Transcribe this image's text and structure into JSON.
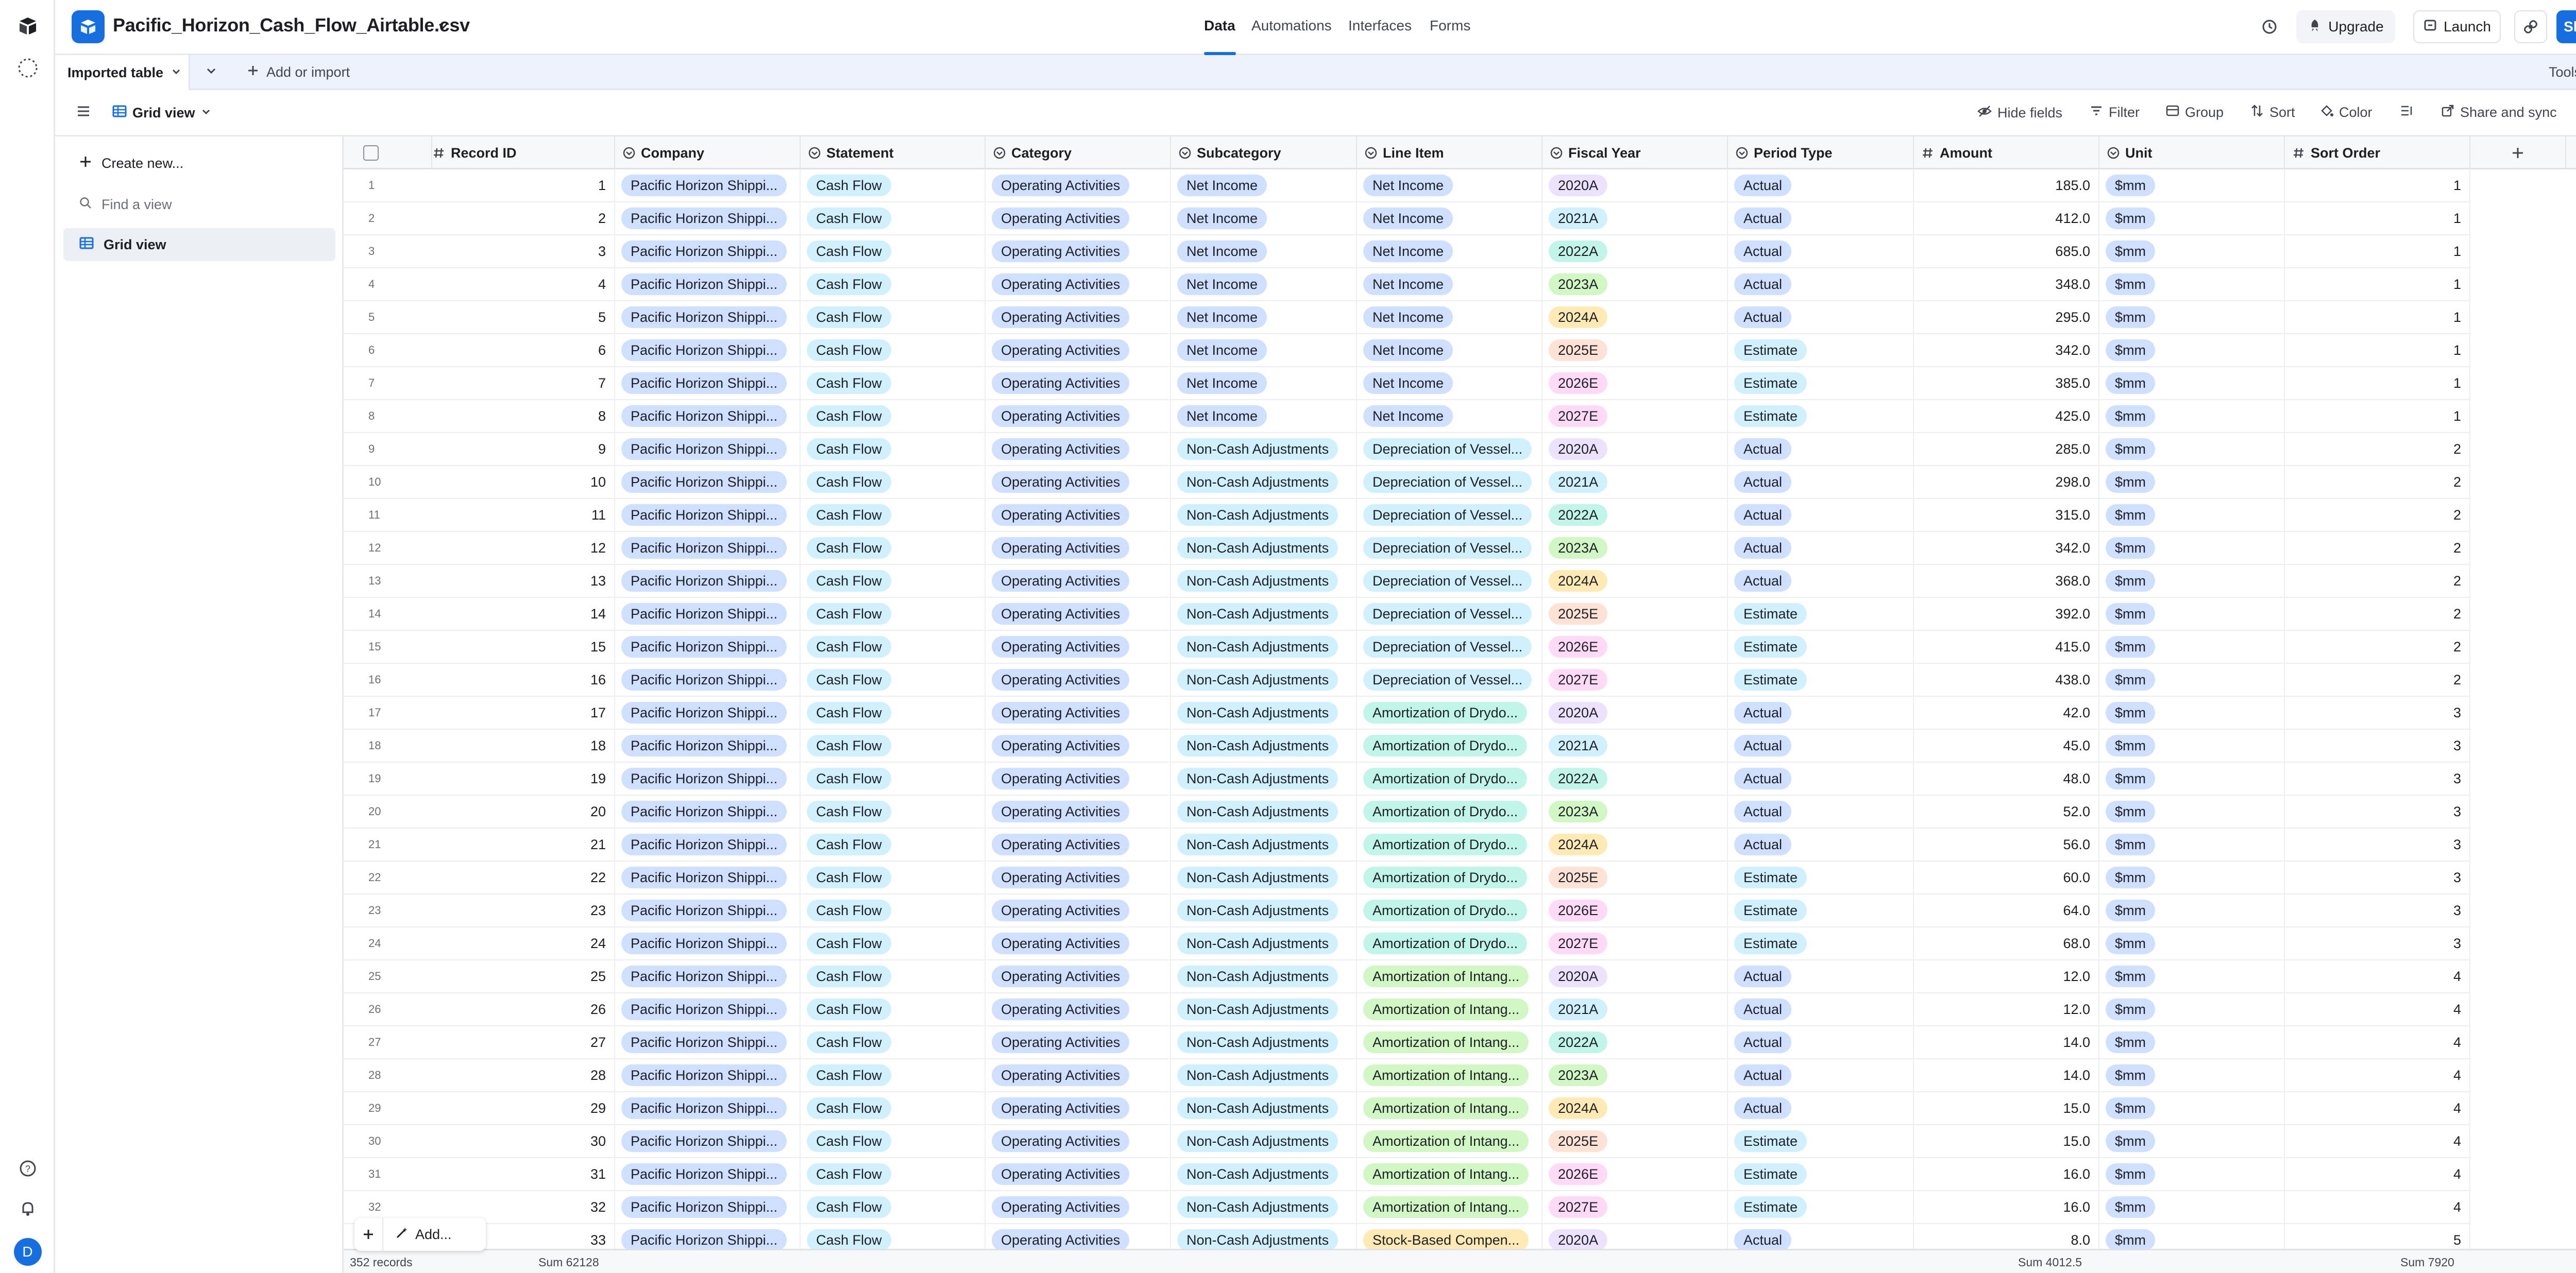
{
  "topbar": {
    "base_name": "Pacific_Horizon_Cash_Flow_Airtable.csv",
    "tabs": [
      "Data",
      "Automations",
      "Interfaces",
      "Forms"
    ],
    "upgrade_label": "Upgrade",
    "launch_label": "Launch",
    "share_label": "Share",
    "accent_color": "#166ee1"
  },
  "tablebar": {
    "table_name": "Imported table",
    "add_label": "Add or import",
    "tools_label": "Tools"
  },
  "viewbar": {
    "view_name": "Grid view",
    "hide_fields": "Hide fields",
    "filter": "Filter",
    "group": "Group",
    "sort": "Sort",
    "color": "Color",
    "share_sync": "Share and sync"
  },
  "sidebar": {
    "create_label": "Create new...",
    "find_placeholder": "Find a view",
    "views": [
      "Grid view"
    ]
  },
  "user": {
    "avatar_initial": "D",
    "avatar_color": "#166ee1"
  },
  "columns": [
    {
      "name": "Record ID",
      "icon": "number-icon"
    },
    {
      "name": "Company",
      "icon": "single-select-icon"
    },
    {
      "name": "Statement",
      "icon": "single-select-icon"
    },
    {
      "name": "Category",
      "icon": "single-select-icon"
    },
    {
      "name": "Subcategory",
      "icon": "single-select-icon"
    },
    {
      "name": "Line Item",
      "icon": "single-select-icon"
    },
    {
      "name": "Fiscal Year",
      "icon": "single-select-icon"
    },
    {
      "name": "Period Type",
      "icon": "single-select-icon"
    },
    {
      "name": "Amount",
      "icon": "number-icon"
    },
    {
      "name": "Unit",
      "icon": "single-select-icon"
    },
    {
      "name": "Sort Order",
      "icon": "number-icon"
    }
  ],
  "rows": [
    {
      "id": "1",
      "company": "Pacific Horizon Shippi...",
      "statement": "Cash Flow",
      "category": "Operating Activities",
      "subcategory": "Net Income",
      "line_item": "Net Income",
      "fiscal_year": "2020A",
      "period_type": "Actual",
      "amount": "185.0",
      "unit": "$mm",
      "sort_order": "1"
    },
    {
      "id": "2",
      "company": "Pacific Horizon Shippi...",
      "statement": "Cash Flow",
      "category": "Operating Activities",
      "subcategory": "Net Income",
      "line_item": "Net Income",
      "fiscal_year": "2021A",
      "period_type": "Actual",
      "amount": "412.0",
      "unit": "$mm",
      "sort_order": "1"
    },
    {
      "id": "3",
      "company": "Pacific Horizon Shippi...",
      "statement": "Cash Flow",
      "category": "Operating Activities",
      "subcategory": "Net Income",
      "line_item": "Net Income",
      "fiscal_year": "2022A",
      "period_type": "Actual",
      "amount": "685.0",
      "unit": "$mm",
      "sort_order": "1"
    },
    {
      "id": "4",
      "company": "Pacific Horizon Shippi...",
      "statement": "Cash Flow",
      "category": "Operating Activities",
      "subcategory": "Net Income",
      "line_item": "Net Income",
      "fiscal_year": "2023A",
      "period_type": "Actual",
      "amount": "348.0",
      "unit": "$mm",
      "sort_order": "1"
    },
    {
      "id": "5",
      "company": "Pacific Horizon Shippi...",
      "statement": "Cash Flow",
      "category": "Operating Activities",
      "subcategory": "Net Income",
      "line_item": "Net Income",
      "fiscal_year": "2024A",
      "period_type": "Actual",
      "amount": "295.0",
      "unit": "$mm",
      "sort_order": "1"
    },
    {
      "id": "6",
      "company": "Pacific Horizon Shippi...",
      "statement": "Cash Flow",
      "category": "Operating Activities",
      "subcategory": "Net Income",
      "line_item": "Net Income",
      "fiscal_year": "2025E",
      "period_type": "Estimate",
      "amount": "342.0",
      "unit": "$mm",
      "sort_order": "1"
    },
    {
      "id": "7",
      "company": "Pacific Horizon Shippi...",
      "statement": "Cash Flow",
      "category": "Operating Activities",
      "subcategory": "Net Income",
      "line_item": "Net Income",
      "fiscal_year": "2026E",
      "period_type": "Estimate",
      "amount": "385.0",
      "unit": "$mm",
      "sort_order": "1"
    },
    {
      "id": "8",
      "company": "Pacific Horizon Shippi...",
      "statement": "Cash Flow",
      "category": "Operating Activities",
      "subcategory": "Net Income",
      "line_item": "Net Income",
      "fiscal_year": "2027E",
      "period_type": "Estimate",
      "amount": "425.0",
      "unit": "$mm",
      "sort_order": "1"
    },
    {
      "id": "9",
      "company": "Pacific Horizon Shippi...",
      "statement": "Cash Flow",
      "category": "Operating Activities",
      "subcategory": "Non-Cash Adjustments",
      "line_item": "Depreciation of Vessel...",
      "fiscal_year": "2020A",
      "period_type": "Actual",
      "amount": "285.0",
      "unit": "$mm",
      "sort_order": "2"
    },
    {
      "id": "10",
      "company": "Pacific Horizon Shippi...",
      "statement": "Cash Flow",
      "category": "Operating Activities",
      "subcategory": "Non-Cash Adjustments",
      "line_item": "Depreciation of Vessel...",
      "fiscal_year": "2021A",
      "period_type": "Actual",
      "amount": "298.0",
      "unit": "$mm",
      "sort_order": "2"
    },
    {
      "id": "11",
      "company": "Pacific Horizon Shippi...",
      "statement": "Cash Flow",
      "category": "Operating Activities",
      "subcategory": "Non-Cash Adjustments",
      "line_item": "Depreciation of Vessel...",
      "fiscal_year": "2022A",
      "period_type": "Actual",
      "amount": "315.0",
      "unit": "$mm",
      "sort_order": "2"
    },
    {
      "id": "12",
      "company": "Pacific Horizon Shippi...",
      "statement": "Cash Flow",
      "category": "Operating Activities",
      "subcategory": "Non-Cash Adjustments",
      "line_item": "Depreciation of Vessel...",
      "fiscal_year": "2023A",
      "period_type": "Actual",
      "amount": "342.0",
      "unit": "$mm",
      "sort_order": "2"
    },
    {
      "id": "13",
      "company": "Pacific Horizon Shippi...",
      "statement": "Cash Flow",
      "category": "Operating Activities",
      "subcategory": "Non-Cash Adjustments",
      "line_item": "Depreciation of Vessel...",
      "fiscal_year": "2024A",
      "period_type": "Actual",
      "amount": "368.0",
      "unit": "$mm",
      "sort_order": "2"
    },
    {
      "id": "14",
      "company": "Pacific Horizon Shippi...",
      "statement": "Cash Flow",
      "category": "Operating Activities",
      "subcategory": "Non-Cash Adjustments",
      "line_item": "Depreciation of Vessel...",
      "fiscal_year": "2025E",
      "period_type": "Estimate",
      "amount": "392.0",
      "unit": "$mm",
      "sort_order": "2"
    },
    {
      "id": "15",
      "company": "Pacific Horizon Shippi...",
      "statement": "Cash Flow",
      "category": "Operating Activities",
      "subcategory": "Non-Cash Adjustments",
      "line_item": "Depreciation of Vessel...",
      "fiscal_year": "2026E",
      "period_type": "Estimate",
      "amount": "415.0",
      "unit": "$mm",
      "sort_order": "2"
    },
    {
      "id": "16",
      "company": "Pacific Horizon Shippi...",
      "statement": "Cash Flow",
      "category": "Operating Activities",
      "subcategory": "Non-Cash Adjustments",
      "line_item": "Depreciation of Vessel...",
      "fiscal_year": "2027E",
      "period_type": "Estimate",
      "amount": "438.0",
      "unit": "$mm",
      "sort_order": "2"
    },
    {
      "id": "17",
      "company": "Pacific Horizon Shippi...",
      "statement": "Cash Flow",
      "category": "Operating Activities",
      "subcategory": "Non-Cash Adjustments",
      "line_item": "Amortization of Drydo...",
      "fiscal_year": "2020A",
      "period_type": "Actual",
      "amount": "42.0",
      "unit": "$mm",
      "sort_order": "3"
    },
    {
      "id": "18",
      "company": "Pacific Horizon Shippi...",
      "statement": "Cash Flow",
      "category": "Operating Activities",
      "subcategory": "Non-Cash Adjustments",
      "line_item": "Amortization of Drydo...",
      "fiscal_year": "2021A",
      "period_type": "Actual",
      "amount": "45.0",
      "unit": "$mm",
      "sort_order": "3"
    },
    {
      "id": "19",
      "company": "Pacific Horizon Shippi...",
      "statement": "Cash Flow",
      "category": "Operating Activities",
      "subcategory": "Non-Cash Adjustments",
      "line_item": "Amortization of Drydo...",
      "fiscal_year": "2022A",
      "period_type": "Actual",
      "amount": "48.0",
      "unit": "$mm",
      "sort_order": "3"
    },
    {
      "id": "20",
      "company": "Pacific Horizon Shippi...",
      "statement": "Cash Flow",
      "category": "Operating Activities",
      "subcategory": "Non-Cash Adjustments",
      "line_item": "Amortization of Drydo...",
      "fiscal_year": "2023A",
      "period_type": "Actual",
      "amount": "52.0",
      "unit": "$mm",
      "sort_order": "3"
    },
    {
      "id": "21",
      "company": "Pacific Horizon Shippi...",
      "statement": "Cash Flow",
      "category": "Operating Activities",
      "subcategory": "Non-Cash Adjustments",
      "line_item": "Amortization of Drydo...",
      "fiscal_year": "2024A",
      "period_type": "Actual",
      "amount": "56.0",
      "unit": "$mm",
      "sort_order": "3"
    },
    {
      "id": "22",
      "company": "Pacific Horizon Shippi...",
      "statement": "Cash Flow",
      "category": "Operating Activities",
      "subcategory": "Non-Cash Adjustments",
      "line_item": "Amortization of Drydo...",
      "fiscal_year": "2025E",
      "period_type": "Estimate",
      "amount": "60.0",
      "unit": "$mm",
      "sort_order": "3"
    },
    {
      "id": "23",
      "company": "Pacific Horizon Shippi...",
      "statement": "Cash Flow",
      "category": "Operating Activities",
      "subcategory": "Non-Cash Adjustments",
      "line_item": "Amortization of Drydo...",
      "fiscal_year": "2026E",
      "period_type": "Estimate",
      "amount": "64.0",
      "unit": "$mm",
      "sort_order": "3"
    },
    {
      "id": "24",
      "company": "Pacific Horizon Shippi...",
      "statement": "Cash Flow",
      "category": "Operating Activities",
      "subcategory": "Non-Cash Adjustments",
      "line_item": "Amortization of Drydo...",
      "fiscal_year": "2027E",
      "period_type": "Estimate",
      "amount": "68.0",
      "unit": "$mm",
      "sort_order": "3"
    },
    {
      "id": "25",
      "company": "Pacific Horizon Shippi...",
      "statement": "Cash Flow",
      "category": "Operating Activities",
      "subcategory": "Non-Cash Adjustments",
      "line_item": "Amortization of Intang...",
      "fiscal_year": "2020A",
      "period_type": "Actual",
      "amount": "12.0",
      "unit": "$mm",
      "sort_order": "4"
    },
    {
      "id": "26",
      "company": "Pacific Horizon Shippi...",
      "statement": "Cash Flow",
      "category": "Operating Activities",
      "subcategory": "Non-Cash Adjustments",
      "line_item": "Amortization of Intang...",
      "fiscal_year": "2021A",
      "period_type": "Actual",
      "amount": "12.0",
      "unit": "$mm",
      "sort_order": "4"
    },
    {
      "id": "27",
      "company": "Pacific Horizon Shippi...",
      "statement": "Cash Flow",
      "category": "Operating Activities",
      "subcategory": "Non-Cash Adjustments",
      "line_item": "Amortization of Intang...",
      "fiscal_year": "2022A",
      "period_type": "Actual",
      "amount": "14.0",
      "unit": "$mm",
      "sort_order": "4"
    },
    {
      "id": "28",
      "company": "Pacific Horizon Shippi...",
      "statement": "Cash Flow",
      "category": "Operating Activities",
      "subcategory": "Non-Cash Adjustments",
      "line_item": "Amortization of Intang...",
      "fiscal_year": "2023A",
      "period_type": "Actual",
      "amount": "14.0",
      "unit": "$mm",
      "sort_order": "4"
    },
    {
      "id": "29",
      "company": "Pacific Horizon Shippi...",
      "statement": "Cash Flow",
      "category": "Operating Activities",
      "subcategory": "Non-Cash Adjustments",
      "line_item": "Amortization of Intang...",
      "fiscal_year": "2024A",
      "period_type": "Actual",
      "amount": "15.0",
      "unit": "$mm",
      "sort_order": "4"
    },
    {
      "id": "30",
      "company": "Pacific Horizon Shippi...",
      "statement": "Cash Flow",
      "category": "Operating Activities",
      "subcategory": "Non-Cash Adjustments",
      "line_item": "Amortization of Intang...",
      "fiscal_year": "2025E",
      "period_type": "Estimate",
      "amount": "15.0",
      "unit": "$mm",
      "sort_order": "4"
    },
    {
      "id": "31",
      "company": "Pacific Horizon Shippi...",
      "statement": "Cash Flow",
      "category": "Operating Activities",
      "subcategory": "Non-Cash Adjustments",
      "line_item": "Amortization of Intang...",
      "fiscal_year": "2026E",
      "period_type": "Estimate",
      "amount": "16.0",
      "unit": "$mm",
      "sort_order": "4"
    },
    {
      "id": "32",
      "company": "Pacific Horizon Shippi...",
      "statement": "Cash Flow",
      "category": "Operating Activities",
      "subcategory": "Non-Cash Adjustments",
      "line_item": "Amortization of Intang...",
      "fiscal_year": "2027E",
      "period_type": "Estimate",
      "amount": "16.0",
      "unit": "$mm",
      "sort_order": "4"
    },
    {
      "id": "33",
      "company": "Pacific Horizon Shippi...",
      "statement": "Cash Flow",
      "category": "Operating Activities",
      "subcategory": "Non-Cash Adjustments",
      "line_item": "Stock-Based Compen...",
      "fiscal_year": "2020A",
      "period_type": "Actual",
      "amount": "8.0",
      "unit": "$mm",
      "sort_order": "5"
    }
  ],
  "pill_colors": {
    "blue": "#cfdfff",
    "cyan": "#d0f0fd",
    "teal": "#c2f5e9",
    "green": "#d1f7c4",
    "yellow": "#ffeab6",
    "orange": "#fee2d5",
    "pink": "#ffdaf6",
    "purple": "#ede2fe",
    "gray": "#e6e8ec"
  },
  "footer": {
    "records": "352 records",
    "sum1": "Sum 62128",
    "sum2": "Sum 4012.5",
    "sum3": "Sum 7920",
    "add_label": "Add..."
  }
}
